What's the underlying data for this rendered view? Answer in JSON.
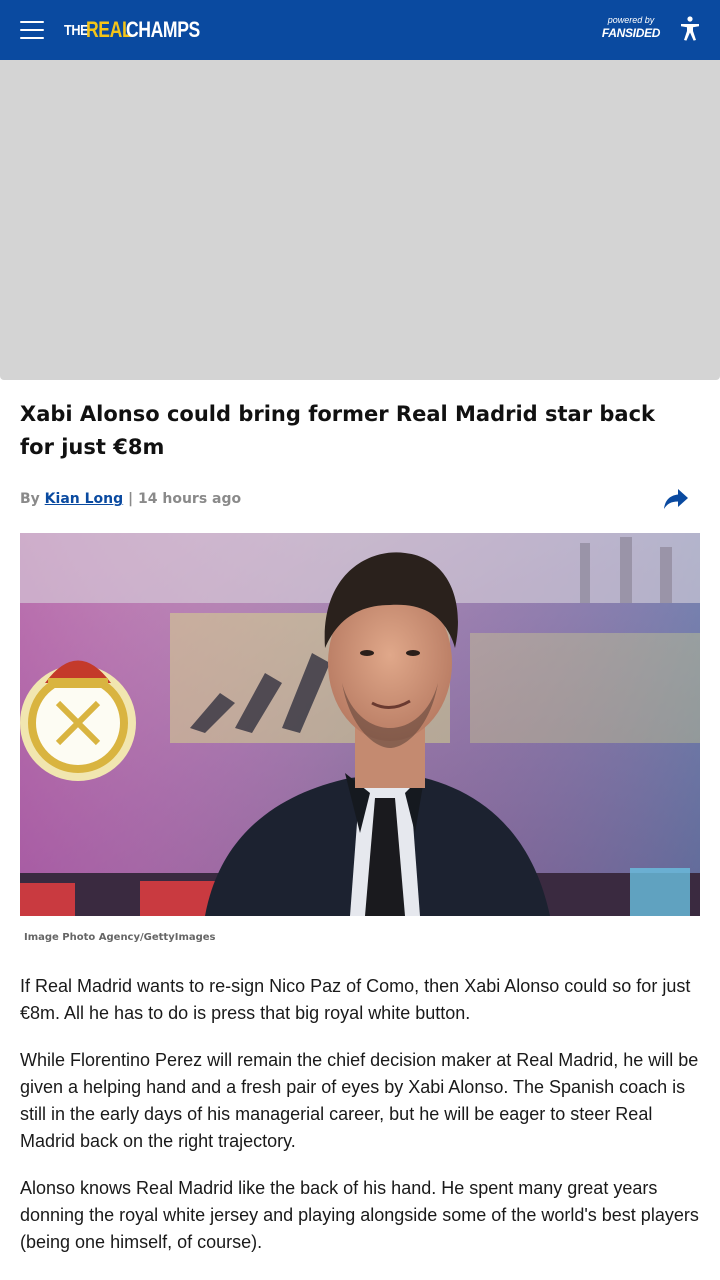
{
  "header": {
    "logo": {
      "the": "THE",
      "real": "REAL",
      "champs": "CHAMPS"
    },
    "powered_by": "powered by",
    "partner": "FANSIDED",
    "menu_icon": "hamburger-menu-icon",
    "accessibility_icon": "accessibility-icon"
  },
  "article": {
    "title": "Xabi Alonso could bring former Real Madrid star back for just €8m",
    "byline_prefix": "By",
    "author": "Kian Long",
    "byline_separator": "|",
    "time_ago": "14 hours ago",
    "share_icon": "share-arrow-icon",
    "image_caption": "Image Photo Agency/GettyImages",
    "paragraphs": [
      "If Real Madrid wants to re-sign Nico Paz of Como, then Xabi Alonso could so for just €8m. All he has to do is press that big royal white button.",
      "While Florentino Perez will remain the chief decision maker at Real Madrid, he will be given a helping hand and a fresh pair of eyes by Xabi Alonso. The Spanish coach is still in the early days of his managerial career, but he will be eager to steer Real Madrid back on the right trajectory.",
      "Alonso knows Real Madrid like the back of his hand. He spent many great years donning the royal white jersey and playing alongside some of the world's best players (being one himself, of course)."
    ]
  },
  "colors": {
    "brand_blue": "#0a4aa0",
    "logo_yellow": "#f5c518",
    "ad_placeholder": "#d4d4d4"
  }
}
